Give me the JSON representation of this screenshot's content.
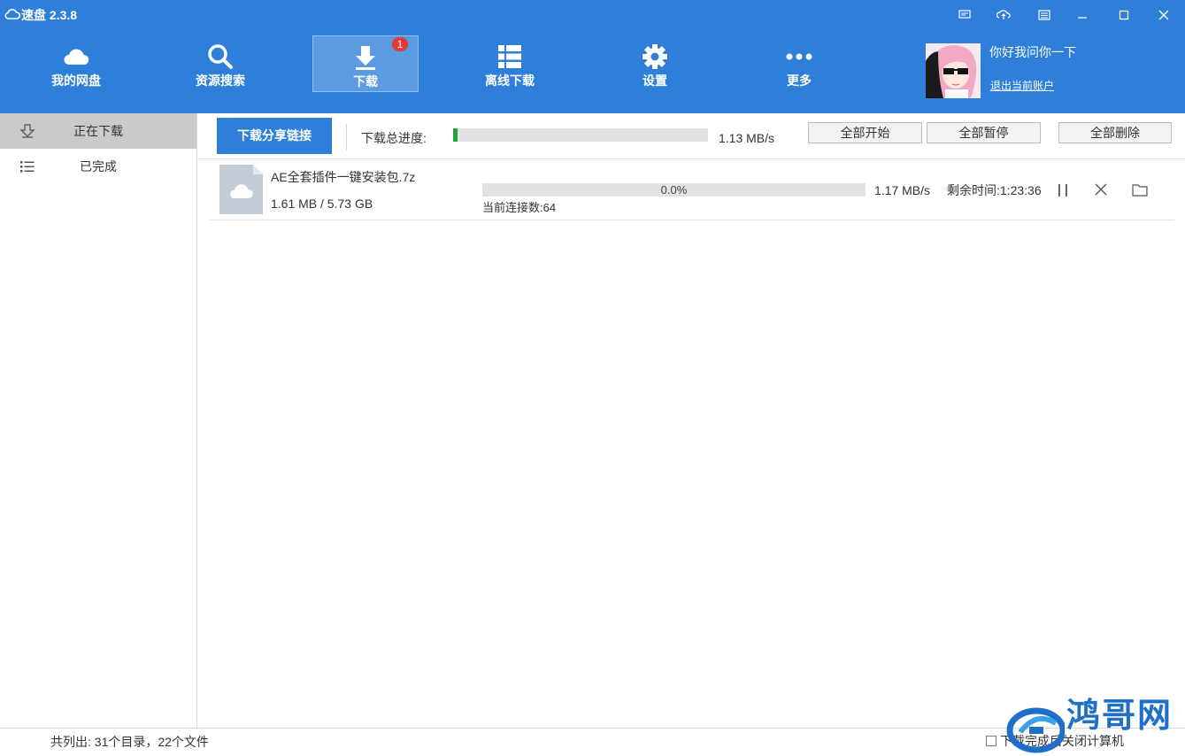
{
  "app": {
    "title": "速盘 2.3.8"
  },
  "titlebar": {
    "buttons": [
      {
        "name": "feedback-icon"
      },
      {
        "name": "cloud-transfer-icon"
      },
      {
        "name": "menu-icon"
      },
      {
        "name": "minimize-icon"
      },
      {
        "name": "maximize-icon"
      },
      {
        "name": "close-icon"
      }
    ]
  },
  "nav": {
    "items": [
      {
        "label": "我的网盘",
        "icon": "cloud-icon"
      },
      {
        "label": "资源搜索",
        "icon": "search-icon"
      },
      {
        "label": "下载",
        "icon": "download-icon",
        "badge": "1"
      },
      {
        "label": "离线下载",
        "icon": "list-icon"
      },
      {
        "label": "设置",
        "icon": "gear-icon"
      },
      {
        "label": "更多",
        "icon": "more-icon"
      }
    ],
    "active_index": 2
  },
  "user": {
    "greeting": "你好我问你一下",
    "logout": "退出当前账户"
  },
  "sidebar": {
    "items": [
      {
        "label": "正在下载",
        "icon": "download-arrow-icon",
        "active": true
      },
      {
        "label": "已完成",
        "icon": "list-icon",
        "active": false
      }
    ]
  },
  "toolbar": {
    "share_label": "下载分享链接",
    "total_label": "下载总进度:",
    "total_speed": "1.13 MB/s",
    "total_progress": 0.017,
    "start_all": "全部开始",
    "pause_all": "全部暂停",
    "delete_all": "全部删除"
  },
  "downloads": [
    {
      "name": "AE全套插件一键安装包.7z",
      "size": "1.61 MB / 5.73 GB",
      "progress_text": "0.0%",
      "progress": 0.0,
      "connections": "当前连接数:64",
      "speed": "1.17 MB/s",
      "remaining": "剩余时间:1:23:36"
    }
  ],
  "status": {
    "summary": "共列出: 31个目录，22个文件",
    "shutdown_label": "下载完成后关闭计算机",
    "shutdown_checked": false
  },
  "watermark": {
    "text": "鸿哥网"
  },
  "colors": {
    "accent": "#2d7fd9",
    "progress": "#1fa43c",
    "badge": "#e53935"
  }
}
